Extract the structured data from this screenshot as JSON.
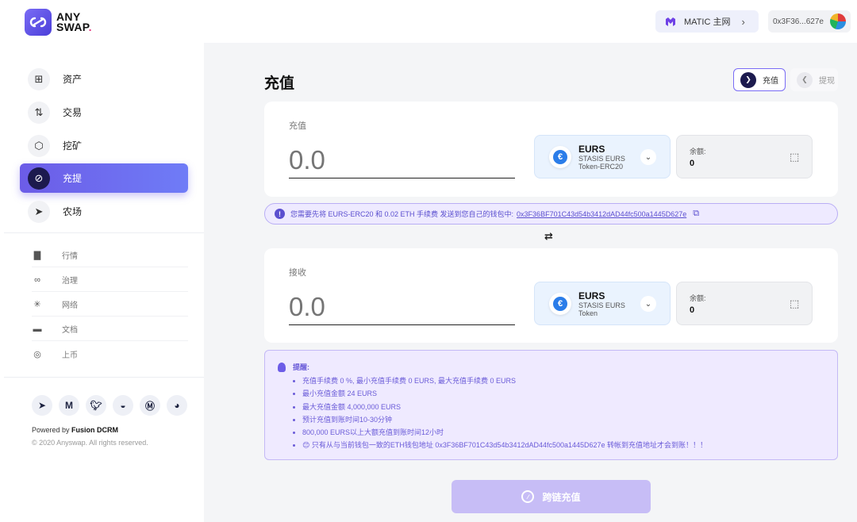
{
  "brand": {
    "line1": "ANY",
    "line2": "SWAP",
    "dot": "."
  },
  "header": {
    "network_label": "MATIC 主网",
    "address": "0x3F36...627e"
  },
  "sidebar": {
    "items": [
      {
        "label": "资产",
        "icon": "grid-icon"
      },
      {
        "label": "交易",
        "icon": "trade-icon"
      },
      {
        "label": "挖矿",
        "icon": "hexagon-icon"
      },
      {
        "label": "充提",
        "icon": "deposit-withdraw-icon",
        "active": true
      },
      {
        "label": "农场",
        "icon": "send-icon"
      }
    ],
    "sub_items": [
      {
        "label": "行情",
        "icon": "chart-icon"
      },
      {
        "label": "治理",
        "icon": "link-icon"
      },
      {
        "label": "网络",
        "icon": "network-icon"
      },
      {
        "label": "文档",
        "icon": "doc-icon"
      },
      {
        "label": "上币",
        "icon": "list-coin-icon"
      }
    ],
    "socials": [
      "telegram-icon",
      "medium-icon",
      "twitter-icon",
      "github-icon",
      "coinmarketcap-icon",
      "coingecko-icon"
    ],
    "powered_prefix": "Powered by ",
    "powered_name": "Fusion DCRM",
    "copyright": "© 2020 Anyswap. All rights reserved."
  },
  "main": {
    "title": "充值",
    "toggle_deposit": "充值",
    "toggle_withdraw": "提现",
    "from": {
      "label": "充值",
      "placeholder": "0.0",
      "token_symbol": "EURS",
      "token_name": "STASIS EURS Token-ERC20",
      "balance_label": "余额:",
      "balance_value": "0"
    },
    "notice_text": "您需要先将 EURS-ERC20 和 0.02 ETH 手续费 发送到您自己的钱包中:",
    "notice_address": "0x3F36BF701C43d54b3412dAD44fc500a1445D627e",
    "to": {
      "label": "接收",
      "placeholder": "0.0",
      "token_symbol": "EURS",
      "token_name": "STASIS EURS Token",
      "balance_label": "余额:",
      "balance_value": "0"
    },
    "tips_title": "提醒:",
    "tips": [
      "充值手续费 0 %, 最小充值手续费 0 EURS, 最大充值手续费 0 EURS",
      "最小充值金额 24 EURS",
      "最大充值金额 4,000,000 EURS",
      "预计充值到账时间10-30分钟",
      "800,000 EURS以上大额充值到账时间12小时",
      "😊 只有从与当前钱包一致的ETH钱包地址 0x3F36BF701C43d54b3412dAD44fc500a1445D627e 转帐到充值地址才会到账！！！"
    ],
    "cta_label": "跨链充值"
  },
  "colors": {
    "accent": "#6c5ce7",
    "notice_bg": "#eeeaff",
    "token_bg": "#eaf3fe"
  }
}
